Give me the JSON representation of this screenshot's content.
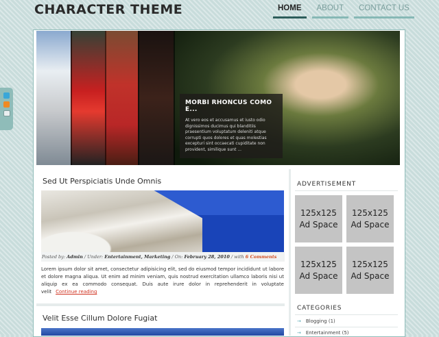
{
  "header": {
    "logo": "CHARACTER THEME",
    "nav": [
      {
        "label": "HOME",
        "active": true
      },
      {
        "label": "ABOUT",
        "active": false
      },
      {
        "label": "CONTACT US",
        "active": false
      }
    ]
  },
  "social": {
    "icons": [
      "twitter-icon",
      "rss-icon",
      "email-icon"
    ]
  },
  "slider": {
    "title_line1": "MORBI RHONCUS COMO",
    "title_line2": "E...",
    "text": "At vero eos et accusamus et iusto odio dignissimos ducimus qui blanditiis praesentium voluptatum deleniti atque corrupti quos dolores et quas molestias excepturi sint occaecati cupiditate non provident, similique sunt ..."
  },
  "post1": {
    "title": "Sed Ut Perspiciatis Unde Omnis",
    "meta": {
      "posted_by_label": "Posted by:",
      "author": "Admin",
      "under_label": "Under:",
      "categories": "Entertainment, Marketing",
      "on_label": "On:",
      "date": "February 28, 2010",
      "with_label": "with",
      "comments": "6 Comments"
    },
    "body": "Lorem ipsum dolor sit amet, consectetur adipisicing elit, sed do eiusmod tempor incididunt ut labore et dolore magna aliqua. Ut enim ad minim veniam, quis nostrud exercitation ullamco laboris nisi ut aliquip ex ea commodo consequat. Duis aute irure dolor in reprehenderit in voluptate velit",
    "read_more": "Continue reading"
  },
  "post2": {
    "title": "Velit Esse Cillum Dolore Fugiat"
  },
  "sidebar": {
    "advertisement_heading": "ADVERTISEMENT",
    "ads": [
      {
        "size": "125x125",
        "label": "Ad Space"
      },
      {
        "size": "125x125",
        "label": "Ad Space"
      },
      {
        "size": "125x125",
        "label": "Ad Space"
      },
      {
        "size": "125x125",
        "label": "Ad Space"
      }
    ],
    "categories_heading": "CATEGORIES",
    "categories": [
      {
        "label": "Blogging (1)"
      },
      {
        "label": "Entertainment (5)"
      }
    ]
  },
  "colors": {
    "accent": "#86b8b5",
    "nav_active": "#2c5d5a",
    "read_more": "#d0311f",
    "ad_bg": "#c4c4c4"
  }
}
